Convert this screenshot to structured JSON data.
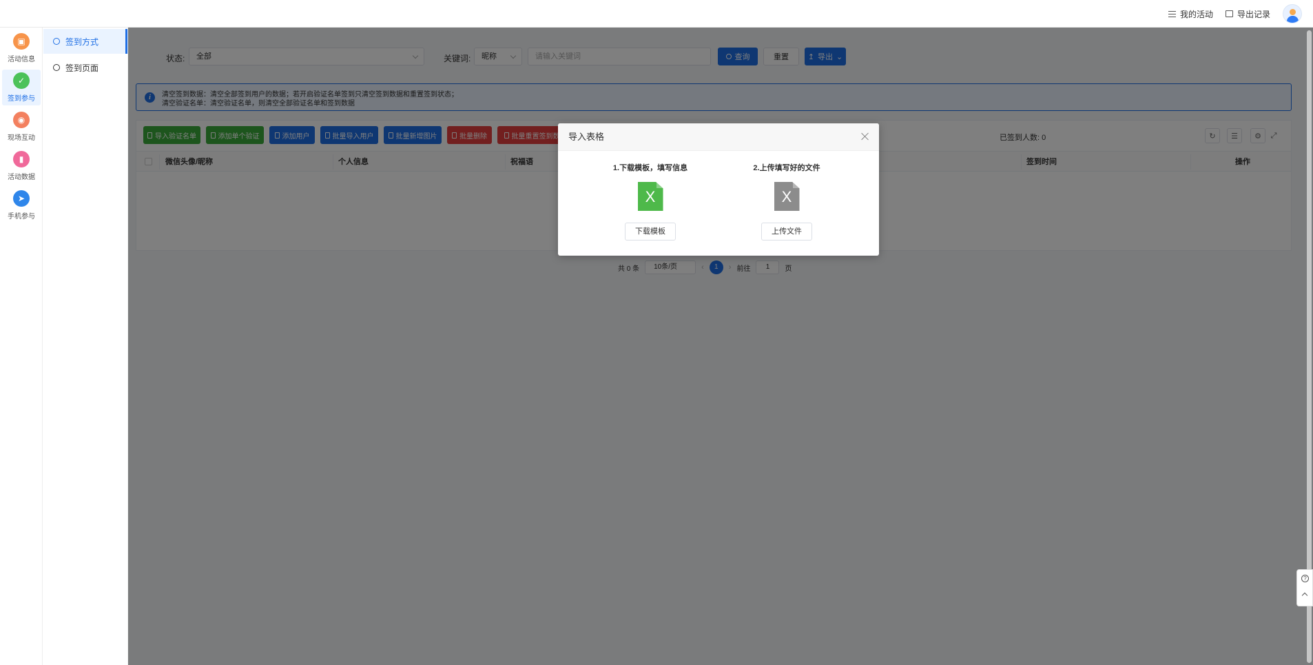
{
  "header": {
    "my_activities": "我的活动",
    "export_records": "导出记录"
  },
  "iconbar": {
    "items": [
      {
        "label": "活动信息",
        "icon": "activity-info-icon",
        "color": "#f7944a"
      },
      {
        "label": "签到参与",
        "icon": "checkin-icon",
        "color": "#4cc25a"
      },
      {
        "label": "现场互动",
        "icon": "live-interaction-icon",
        "color": "#f3805f"
      },
      {
        "label": "活动数据",
        "icon": "activity-data-icon",
        "color": "#f0699a"
      },
      {
        "label": "手机参与",
        "icon": "mobile-participation-icon",
        "color": "#2f86ea"
      }
    ]
  },
  "submenu": {
    "items": [
      {
        "label": "签到方式"
      },
      {
        "label": "签到页面"
      }
    ]
  },
  "filter": {
    "status_label": "状态:",
    "status_value": "全部",
    "keyword_label": "关键词:",
    "keyword_type": "昵称",
    "keyword_placeholder": "请输入关键词",
    "query_btn": "查询",
    "reset_btn": "重置",
    "export_btn": "导出"
  },
  "alert": {
    "line1": "清空签到数据：清空全部签到用户的数据；若开启验证名单签到只清空签到数据和重置签到状态；",
    "line2": "清空验证名单：清空验证名单，则清空全部验证名单和签到数据"
  },
  "toolbar": {
    "buttons": [
      {
        "label": "导入验证名单",
        "color": "green"
      },
      {
        "label": "添加单个验证",
        "color": "green"
      },
      {
        "label": "添加用户",
        "color": "blue"
      },
      {
        "label": "批量导入用户",
        "color": "blue"
      },
      {
        "label": "批量新增图片",
        "color": "blue"
      },
      {
        "label": "批量删除",
        "color": "red"
      },
      {
        "label": "批量重置签到数据",
        "color": "red"
      }
    ],
    "checked_count": "已签到人数: 0"
  },
  "table": {
    "columns": [
      "微信头像/昵称",
      "个人信息",
      "祝福语",
      "",
      "签到时间",
      "操作"
    ]
  },
  "pagination": {
    "total": "共 0 条",
    "page_size": "10条/页",
    "current_page": "1",
    "goto_label": "前往",
    "goto_value": "1",
    "page_suffix": "页"
  },
  "modal": {
    "title": "导入表格",
    "step1": "1.下载模板，填写信息",
    "step2": "2.上传填写好的文件",
    "file_glyph": "X",
    "download_btn": "下载模板",
    "upload_btn": "上传文件"
  },
  "colors": {
    "primary": "#1f6fe5",
    "green": "#3aab3a",
    "red": "#e53e3e"
  }
}
